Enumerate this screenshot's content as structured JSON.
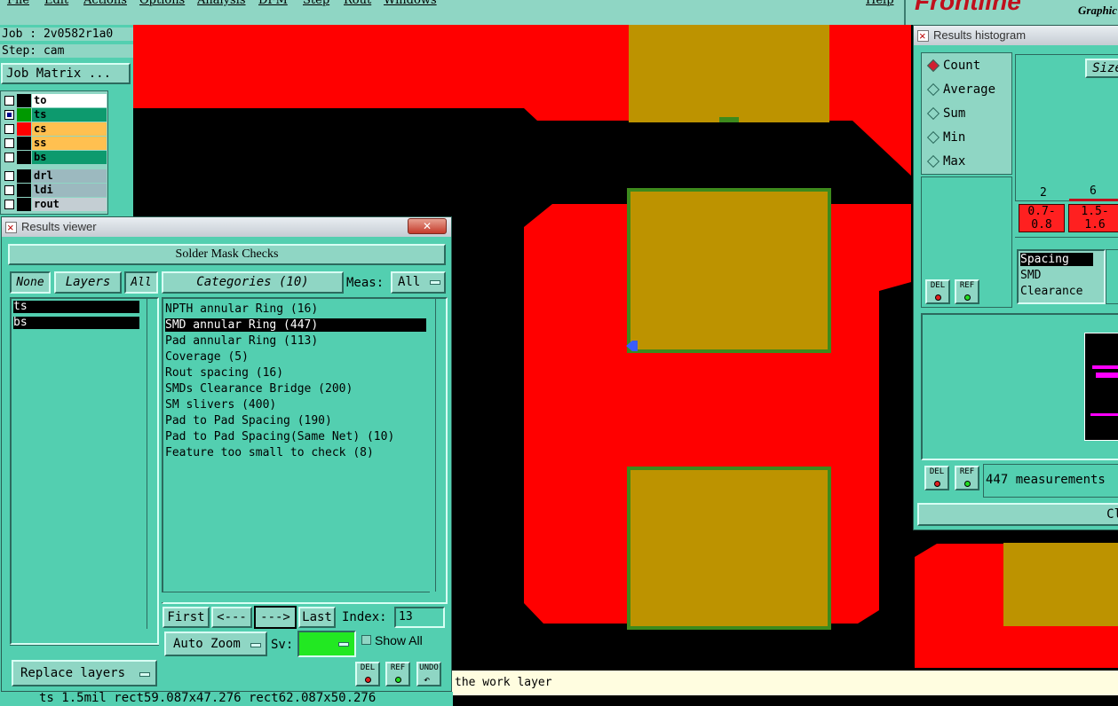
{
  "menu": {
    "items": [
      "File",
      "Edit",
      "Actions",
      "Options",
      "Analysis",
      "DFM",
      "Step",
      "Rout",
      "Windows"
    ],
    "help": "Help"
  },
  "brand": {
    "logo": "Frontline",
    "sub": "Graphic"
  },
  "job": {
    "job_line": "Job : 2v0582r1a0",
    "step_line": "Step: cam",
    "matrix_button": "Job Matrix ..."
  },
  "layers": [
    {
      "name": "to",
      "color": "#000000",
      "bg": "#ffffff",
      "checked": false
    },
    {
      "name": "ts",
      "color": "#009900",
      "bg": "#0d9a6e",
      "checked": true
    },
    {
      "name": "cs",
      "color": "#ff0000",
      "bg": "#ffc050",
      "checked": false
    },
    {
      "name": "ss",
      "color": "#000000",
      "bg": "#ffc050",
      "checked": false
    },
    {
      "name": "bs",
      "color": "#000000",
      "bg": "#0d9a6e",
      "checked": false
    },
    {
      "name": "drl",
      "color": "#000000",
      "bg": "#9cb9bf",
      "checked": false
    },
    {
      "name": "ldi",
      "color": "#000000",
      "bg": "#9cb9bf",
      "checked": false
    },
    {
      "name": "rout",
      "color": "#000000",
      "bg": "#c4ced3",
      "checked": false
    }
  ],
  "results_viewer": {
    "title": "Results viewer",
    "heading": "Solder Mask Checks",
    "none_btn": "None",
    "layers_btn": "Layers",
    "all_btn": "All",
    "layers_list": [
      "ts",
      "bs"
    ],
    "categories_btn": "Categories (10)",
    "meas_label": "Meas:",
    "meas_value": "All",
    "categories": [
      "NPTH annular Ring (16)",
      "SMD annular Ring (447)",
      "Pad annular Ring (113)",
      "Coverage (5)",
      "Rout spacing (16)",
      "SMDs Clearance Bridge (200)",
      "SM slivers (400)",
      "Pad to Pad Spacing (190)",
      "Pad to Pad Spacing(Same Net) (10)",
      "Feature too small to check (8)"
    ],
    "selected_index": 1,
    "nav": {
      "first": "First",
      "prev": "<---",
      "next": "--->",
      "last": "Last",
      "index_label": "Index:",
      "index_value": "13"
    },
    "auto_zoom": "Auto Zoom",
    "sv_label": "Sv:",
    "show_all": "Show All",
    "replace_layers": "Replace layers",
    "del": "DEL",
    "ref": "REF",
    "undo": "UNDO"
  },
  "histogram": {
    "title": "Results histogram",
    "options": [
      "Count",
      "Average",
      "Sum",
      "Min",
      "Max"
    ],
    "selected_option": "Count",
    "size_label": "Size",
    "bars": [
      {
        "count": "2",
        "range_top": "0.7-",
        "range_bottom": "0.8"
      },
      {
        "count": "6",
        "range_top": "1.5-",
        "range_bottom": "1.6"
      }
    ],
    "types": [
      "Spacing",
      "SMD",
      "Clearance"
    ],
    "selected_type": "Spacing",
    "measurements": "447 measurements",
    "close": "Cl",
    "del": "DEL",
    "ref": "REF"
  },
  "status": {
    "message": "the work layer",
    "bottom": "ts 1.5mil  rect59.087x47.276  rect62.087x50.276"
  },
  "colors": {
    "panel": "#53cfb0",
    "copper": "#ff0000",
    "pad": "#bd9300",
    "mask_edge": "#3d8a1c"
  }
}
